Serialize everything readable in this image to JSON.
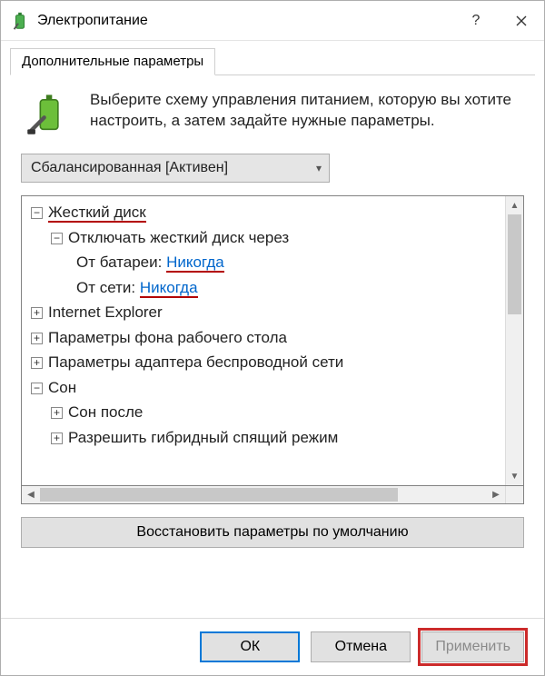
{
  "window": {
    "title": "Электропитание"
  },
  "tabs": {
    "active": "Дополнительные параметры"
  },
  "intro": {
    "text": "Выберите схему управления питанием, которую вы хотите настроить, а затем задайте нужные параметры."
  },
  "plan": {
    "selected": "Сбалансированная [Активен]"
  },
  "tree": {
    "hard_disk": "Жесткий диск",
    "turn_off_after": "Отключать жесткий диск через",
    "on_battery_label": "От батареи:",
    "on_battery_value": "Никогда",
    "plugged_label": "От сети:",
    "plugged_value": "Никогда",
    "ie": "Internet Explorer",
    "desktop_bg": "Параметры фона рабочего стола",
    "wireless": "Параметры адаптера беспроводной сети",
    "sleep": "Сон",
    "sleep_after": "Сон после",
    "hybrid_sleep": "Разрешить гибридный спящий режим"
  },
  "buttons": {
    "restore_defaults": "Восстановить параметры по умолчанию",
    "ok": "ОК",
    "cancel": "Отмена",
    "apply": "Применить"
  }
}
